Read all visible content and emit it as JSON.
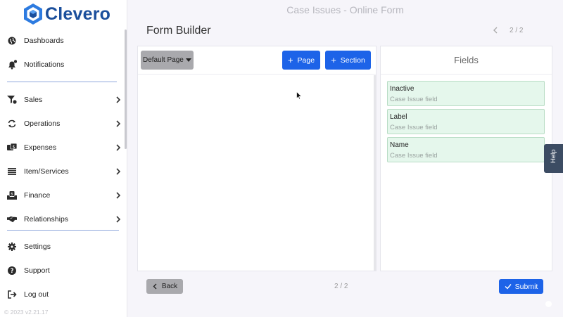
{
  "brand": {
    "name": "Clevero"
  },
  "sidebar": {
    "items": [
      {
        "label": "Dashboards",
        "icon": "globe-icon"
      },
      {
        "label": "Notifications",
        "icon": "bell-icon"
      },
      {
        "label": "Sales",
        "icon": "funnel-icon"
      },
      {
        "label": "Operations",
        "icon": "sync-icon"
      },
      {
        "label": "Expenses",
        "icon": "money-icon"
      },
      {
        "label": "Item/Services",
        "icon": "list-icon"
      },
      {
        "label": "Finance",
        "icon": "inbox-money-icon"
      },
      {
        "label": "Relationships",
        "icon": "handshake-icon"
      },
      {
        "label": "Settings",
        "icon": "gear-icon"
      },
      {
        "label": "Support",
        "icon": "question-icon"
      },
      {
        "label": "Log out",
        "icon": "logout-icon"
      }
    ],
    "version": "© 2023   v2.21.17"
  },
  "header": {
    "window_title": "Case Issues - Online Form",
    "builder_title": "Form Builder",
    "pager": "2 / 2"
  },
  "builder": {
    "page_select": "Default Page",
    "page_button": "Page",
    "section_button": "Section"
  },
  "fields": {
    "title": "Fields",
    "items": [
      {
        "name": "Inactive",
        "type": "Case Issue field"
      },
      {
        "name": "Label",
        "type": "Case Issue field"
      },
      {
        "name": "Name",
        "type": "Case Issue field"
      }
    ]
  },
  "help": {
    "label": "Help"
  },
  "footer": {
    "back_label": "Back",
    "pager": "2 / 2",
    "submit_label": "Submit"
  },
  "colors": {
    "accent": "#1d63e8",
    "brand": "#1b4f9c",
    "field_bg": "#e5f7ec",
    "help_tab": "#3c4c63"
  }
}
